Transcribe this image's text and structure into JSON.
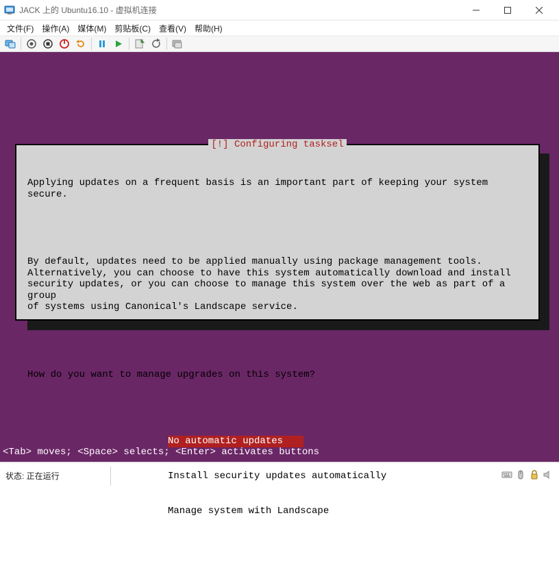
{
  "window": {
    "title": "JACK 上的 Ubuntu16.10 - 虚拟机连接"
  },
  "menu": {
    "items": [
      "文件(F)",
      "操作(A)",
      "媒体(M)",
      "剪贴板(C)",
      "查看(V)",
      "帮助(H)"
    ]
  },
  "toolbar": {
    "icons": [
      "connect",
      "record-off",
      "stop",
      "shutdown",
      "restart",
      "pause",
      "play",
      "snapshot",
      "revert",
      "enhanced"
    ]
  },
  "dialog": {
    "title": "[!] Configuring tasksel",
    "para1": "Applying updates on a frequent basis is an important part of keeping your system secure.",
    "para2": "By default, updates need to be applied manually using package management tools.\nAlternatively, you can choose to have this system automatically download and install\nsecurity updates, or you can choose to manage this system over the web as part of a group\nof systems using Canonical's Landscape service.",
    "question": "How do you want to manage upgrades on this system?",
    "options": [
      "No automatic updates",
      "Install security updates automatically",
      "Manage system with Landscape"
    ],
    "selected_index": 0
  },
  "hint": "<Tab> moves; <Space> selects; <Enter> activates buttons",
  "status": {
    "label": "状态: 正在运行"
  }
}
